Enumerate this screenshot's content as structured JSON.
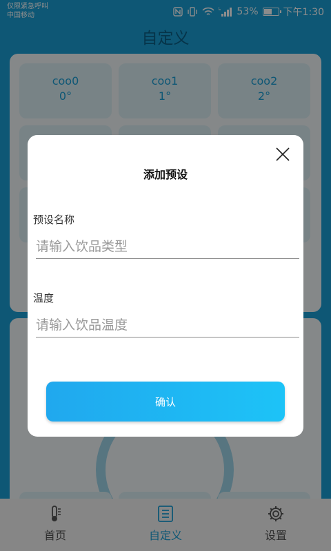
{
  "status_bar": {
    "carrier_line1": "仅限紧急呼叫",
    "carrier_line2": "中国移动",
    "battery": "53%",
    "time": "下午1:30",
    "icons": [
      "nfc-icon",
      "vibrate-icon",
      "wifi-icon",
      "4g-signal-icon",
      "battery-icon"
    ]
  },
  "header": {
    "title": "自定义"
  },
  "presets": [
    {
      "name": "coo0",
      "temp": "0°"
    },
    {
      "name": "coo1",
      "temp": "1°"
    },
    {
      "name": "coo2",
      "temp": "2°"
    }
  ],
  "dialog": {
    "title": "添加预设",
    "name_label": "预设名称",
    "name_placeholder": "请输入饮品类型",
    "temp_label": "温度",
    "temp_placeholder": "请输入饮品温度",
    "confirm_label": "确认"
  },
  "tabbar": {
    "items": [
      {
        "label": "首页",
        "icon": "thermometer-icon"
      },
      {
        "label": "自定义",
        "icon": "list-icon",
        "active": true
      },
      {
        "label": "设置",
        "icon": "gear-icon"
      }
    ]
  },
  "colors": {
    "brand": "#1a9fd6",
    "title": "#0c5f86",
    "button_gradient_start": "#20a8ee",
    "button_gradient_end": "#1dc3f7"
  }
}
